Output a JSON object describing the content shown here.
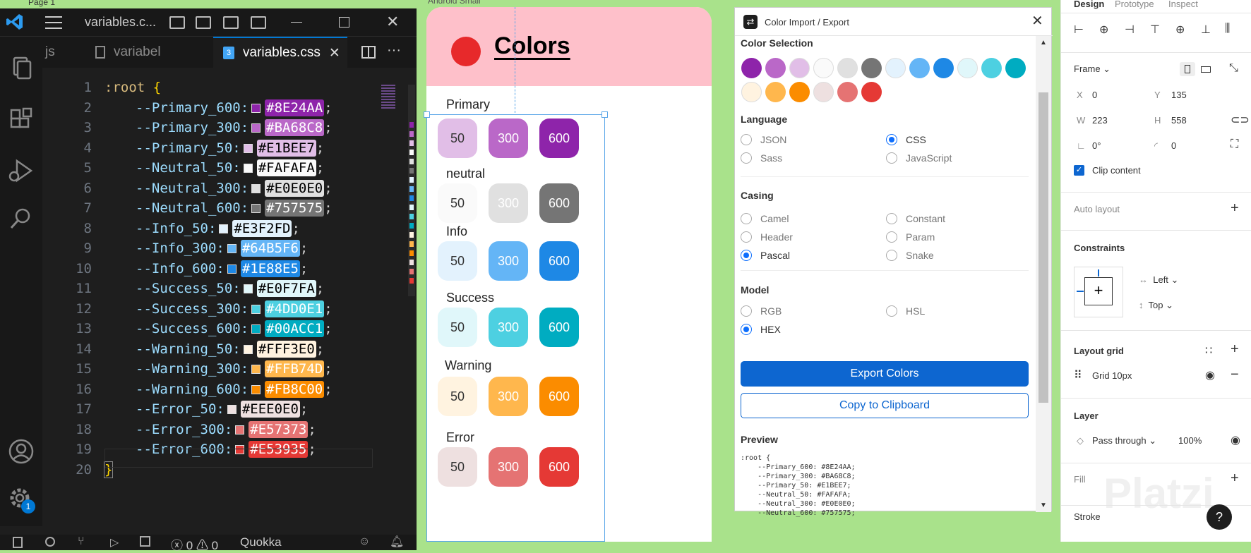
{
  "top_strip": {
    "page_label": "Page 1",
    "frame_label": "Android Small"
  },
  "vscode": {
    "title": "variables.c...",
    "tabs": [
      {
        "label": "js"
      },
      {
        "label": "variabel"
      },
      {
        "label": "variables.css"
      }
    ],
    "notification_badge": "1",
    "code_lines": [
      {
        "num": "1",
        "prop": ":root",
        "val": "",
        "hex": "",
        "color": ""
      },
      {
        "num": "2",
        "prop": "--Primary_600:",
        "hex": "#8E24AA",
        "color": "#8E24AA"
      },
      {
        "num": "3",
        "prop": "--Primary_300:",
        "hex": "#BA68C8",
        "color": "#BA68C8"
      },
      {
        "num": "4",
        "prop": "--Primary_50:",
        "hex": "#E1BEE7",
        "color": "#E1BEE7"
      },
      {
        "num": "5",
        "prop": "--Neutral_50:",
        "hex": "#FAFAFA",
        "color": "#FAFAFA"
      },
      {
        "num": "6",
        "prop": "--Neutral_300:",
        "hex": "#E0E0E0",
        "color": "#E0E0E0"
      },
      {
        "num": "7",
        "prop": "--Neutral_600:",
        "hex": "#757575",
        "color": "#757575"
      },
      {
        "num": "8",
        "prop": "--Info_50:",
        "hex": "#E3F2FD",
        "color": "#E3F2FD"
      },
      {
        "num": "9",
        "prop": "--Info_300:",
        "hex": "#64B5F6",
        "color": "#64B5F6"
      },
      {
        "num": "10",
        "prop": "--Info_600:",
        "hex": "#1E88E5",
        "color": "#1E88E5"
      },
      {
        "num": "11",
        "prop": "--Success_50:",
        "hex": "#E0F7FA",
        "color": "#E0F7FA"
      },
      {
        "num": "12",
        "prop": "--Success_300:",
        "hex": "#4DD0E1",
        "color": "#4DD0E1"
      },
      {
        "num": "13",
        "prop": "--Success_600:",
        "hex": "#00ACC1",
        "color": "#00ACC1"
      },
      {
        "num": "14",
        "prop": "--Warning_50:",
        "hex": "#FFF3E0",
        "color": "#FFF3E0"
      },
      {
        "num": "15",
        "prop": "--Warning_300:",
        "hex": "#FFB74D",
        "color": "#FFB74D"
      },
      {
        "num": "16",
        "prop": "--Warning_600:",
        "hex": "#FB8C00",
        "color": "#FB8C00"
      },
      {
        "num": "17",
        "prop": "--Error_50:",
        "hex": "#EEE0E0",
        "color": "#EEE0E0"
      },
      {
        "num": "18",
        "prop": "--Error_300:",
        "hex": "#E57373",
        "color": "#E57373"
      },
      {
        "num": "19",
        "prop": "--Error_600:",
        "hex": "#E53935",
        "color": "#E53935"
      },
      {
        "num": "20",
        "prop": "}",
        "hex": "",
        "color": ""
      }
    ],
    "status": {
      "errors": "0",
      "warnings": "0",
      "extension": "Quokka"
    }
  },
  "canvas": {
    "title": "Colors",
    "groups": [
      {
        "label": "Primary",
        "chips": [
          {
            "t": "50",
            "c": "#E1BEE7",
            "f": "#333"
          },
          {
            "t": "300",
            "c": "#BA68C8",
            "f": "#fff"
          },
          {
            "t": "600",
            "c": "#8E24AA",
            "f": "#fff"
          }
        ]
      },
      {
        "label": "neutral",
        "chips": [
          {
            "t": "50",
            "c": "#FAFAFA",
            "f": "#333"
          },
          {
            "t": "300",
            "c": "#E0E0E0",
            "f": "#fff"
          },
          {
            "t": "600",
            "c": "#757575",
            "f": "#fff"
          }
        ]
      },
      {
        "label": "Info",
        "chips": [
          {
            "t": "50",
            "c": "#E3F2FD",
            "f": "#333"
          },
          {
            "t": "300",
            "c": "#64B5F6",
            "f": "#fff"
          },
          {
            "t": "600",
            "c": "#1E88E5",
            "f": "#fff"
          }
        ]
      },
      {
        "label": "Success",
        "chips": [
          {
            "t": "50",
            "c": "#E0F7FA",
            "f": "#333"
          },
          {
            "t": "300",
            "c": "#4DD0E1",
            "f": "#fff"
          },
          {
            "t": "600",
            "c": "#00ACC1",
            "f": "#fff"
          }
        ]
      },
      {
        "label": "Warning",
        "chips": [
          {
            "t": "50",
            "c": "#FFF3E0",
            "f": "#333"
          },
          {
            "t": "300",
            "c": "#FFB74D",
            "f": "#fff"
          },
          {
            "t": "600",
            "c": "#FB8C00",
            "f": "#fff"
          }
        ]
      },
      {
        "label": "Error",
        "chips": [
          {
            "t": "50",
            "c": "#EEE0E0",
            "f": "#333"
          },
          {
            "t": "300",
            "c": "#E57373",
            "f": "#fff"
          },
          {
            "t": "600",
            "c": "#E53935",
            "f": "#fff"
          }
        ]
      }
    ]
  },
  "plugin": {
    "title": "Color Import / Export",
    "color_selection_label": "Color Selection",
    "swatches": [
      "#8E24AA",
      "#BA68C8",
      "#E1BEE7",
      "#FAFAFA",
      "#E0E0E0",
      "#757575",
      "#E3F2FD",
      "#64B5F6",
      "#1E88E5",
      "#E0F7FA",
      "#4DD0E1",
      "#00ACC1",
      "#FFF3E0",
      "#FFB74D",
      "#FB8C00",
      "#EEE0E0",
      "#E57373",
      "#E53935"
    ],
    "language": {
      "label": "Language",
      "options": [
        {
          "t": "JSON",
          "on": false
        },
        {
          "t": "CSS",
          "on": true
        },
        {
          "t": "Sass",
          "on": false
        },
        {
          "t": "JavaScript",
          "on": false
        }
      ]
    },
    "casing": {
      "label": "Casing",
      "options": [
        {
          "t": "Camel",
          "on": false
        },
        {
          "t": "Constant",
          "on": false
        },
        {
          "t": "Header",
          "on": false
        },
        {
          "t": "Param",
          "on": false
        },
        {
          "t": "Pascal",
          "on": true
        },
        {
          "t": "Snake",
          "on": false
        }
      ]
    },
    "model": {
      "label": "Model",
      "options": [
        {
          "t": "RGB",
          "on": false
        },
        {
          "t": "HSL",
          "on": false
        },
        {
          "t": "HEX",
          "on": true
        }
      ]
    },
    "export_label": "Export Colors",
    "copy_label": "Copy to Clipboard",
    "preview_label": "Preview",
    "preview_text": ":root {\n    --Primary_600: #8E24AA;\n    --Primary_300: #BA68C8;\n    --Primary_50: #E1BEE7;\n    --Neutral_50: #FAFAFA;\n    --Neutral_300: #E0E0E0;\n    --Neutral_600: #757575;"
  },
  "right_panel": {
    "tabs": [
      "Design",
      "Prototype",
      "Inspect"
    ],
    "frame_label": "Frame",
    "x": "0",
    "y": "135",
    "w": "223",
    "h": "558",
    "rotation": "0°",
    "radius": "0",
    "x_label": "X",
    "y_label": "Y",
    "w_label": "W",
    "h_label": "H",
    "clip_content": "Clip content",
    "auto_layout": "Auto layout",
    "constraints": "Constraints",
    "constraint_h": "Left",
    "constraint_v": "Top",
    "layout_grid": "Layout grid",
    "grid_item": "Grid 10px",
    "layer": "Layer",
    "blend": "Pass through",
    "opacity": "100%",
    "fill": "Fill",
    "stroke": "Stroke",
    "watermark": "Platzi",
    "help": "?"
  }
}
